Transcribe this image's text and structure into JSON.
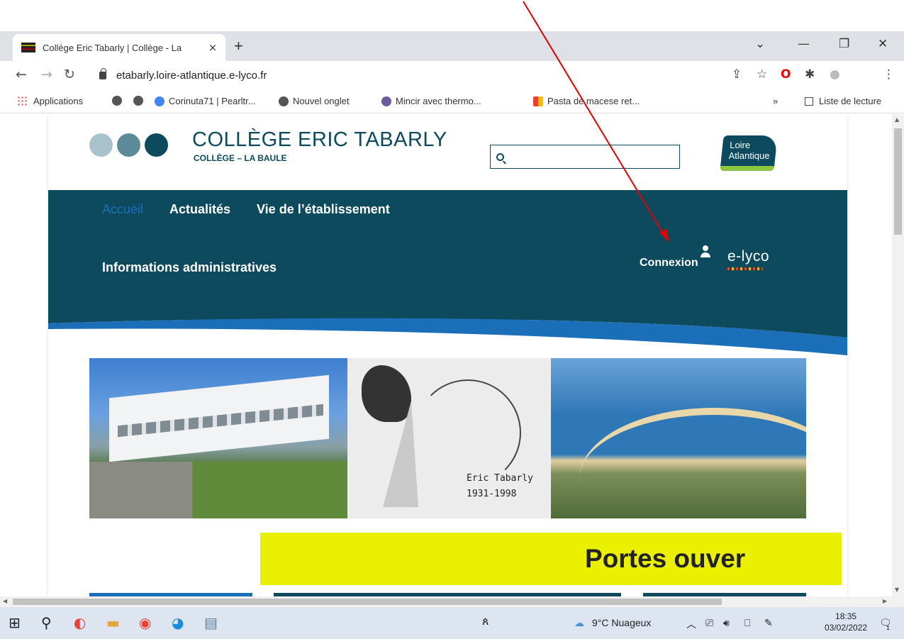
{
  "browser": {
    "tab_title": "Collège Eric Tabarly | Collège - La",
    "tab_close": "×",
    "new_tab": "+",
    "url": "etabarly.loire-atlantique.e-lyco.fr",
    "bookmarks": [
      "Applications",
      "Corinuta71 | Pearltr...",
      "Nouvel onglet",
      "Mincir avec thermo...",
      "Pasta de macese ret..."
    ],
    "more_bookmarks": "»",
    "reading_list": "Liste de lecture"
  },
  "site": {
    "title": "COLLÈGE ERIC TABARLY",
    "subtitle": "COLLÈGE – LA BAULE",
    "search_placeholder": "",
    "partner_logo": [
      "Loire",
      "Atlantique"
    ],
    "dot_colors": [
      "#a9c3cc",
      "#5d8a99",
      "#0d4a5e"
    ],
    "nav": {
      "home": "Accueil",
      "news": "Actualités",
      "school_life": "Vie de l’établissement",
      "admin_info": "Informations administratives"
    },
    "login": "Connexion",
    "elyco_logo": "e-lyco",
    "banner_caption": [
      "Eric Tabarly",
      "1931-1998"
    ],
    "announcement": "Portes ouver"
  },
  "taskbar": {
    "weather": "9°C Nuageux",
    "time": "18:35",
    "date": "03/02/2022",
    "notification_count": "1"
  },
  "colors": {
    "brand": "#0d4a5e",
    "accent": "#1a6fb8",
    "highlight": "#eaf000",
    "annotation": "#e00000"
  }
}
